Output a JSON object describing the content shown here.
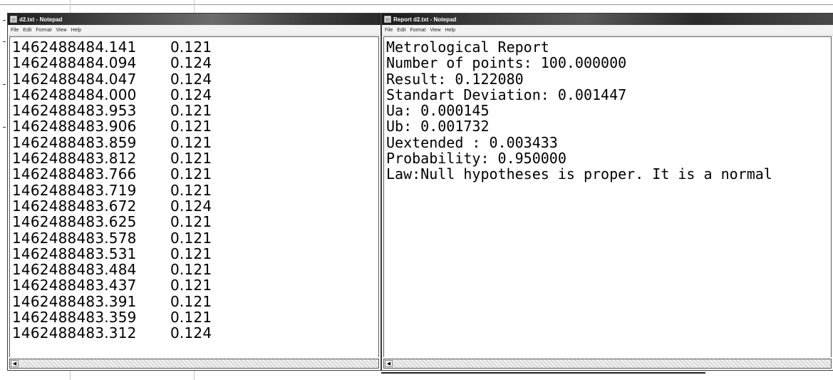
{
  "left_window": {
    "title": "d2.txt - Notepad",
    "menu": [
      "File",
      "Edit",
      "Format",
      "View",
      "Help"
    ],
    "rows": [
      {
        "timestamp": "1462488484.141",
        "value": "0.121"
      },
      {
        "timestamp": "1462488484.094",
        "value": "0.124"
      },
      {
        "timestamp": "1462488484.047",
        "value": "0.124"
      },
      {
        "timestamp": "1462488484.000",
        "value": "0.124"
      },
      {
        "timestamp": "1462488483.953",
        "value": "0.121"
      },
      {
        "timestamp": "1462488483.906",
        "value": "0.121"
      },
      {
        "timestamp": "1462488483.859",
        "value": "0.121"
      },
      {
        "timestamp": "1462488483.812",
        "value": "0.121"
      },
      {
        "timestamp": "1462488483.766",
        "value": "0.121"
      },
      {
        "timestamp": "1462488483.719",
        "value": "0.121"
      },
      {
        "timestamp": "1462488483.672",
        "value": "0.124"
      },
      {
        "timestamp": "1462488483.625",
        "value": "0.121"
      },
      {
        "timestamp": "1462488483.578",
        "value": "0.121"
      },
      {
        "timestamp": "1462488483.531",
        "value": "0.121"
      },
      {
        "timestamp": "1462488483.484",
        "value": "0.121"
      },
      {
        "timestamp": "1462488483.437",
        "value": "0.121"
      },
      {
        "timestamp": "1462488483.391",
        "value": "0.121"
      },
      {
        "timestamp": "1462488483.359",
        "value": "0.121"
      },
      {
        "timestamp": "1462488483.312",
        "value": "0.124"
      }
    ],
    "scroll_left_glyph": "◀"
  },
  "right_window": {
    "title": "Report d2.txt - Notepad",
    "menu": [
      "File",
      "Edit",
      "Format",
      "View",
      "Help"
    ],
    "lines": [
      "Metrological Report",
      "Number of points: 100.000000",
      "Result: 0.122080",
      "Standart Deviation: 0.001447",
      "Ua: 0.000145",
      "Ub: 0.001732",
      "Uextended : 0.003433",
      "Probability: 0.950000",
      "Law:Null hypotheses is proper. It is a normal"
    ],
    "scroll_left_glyph": "◀"
  }
}
